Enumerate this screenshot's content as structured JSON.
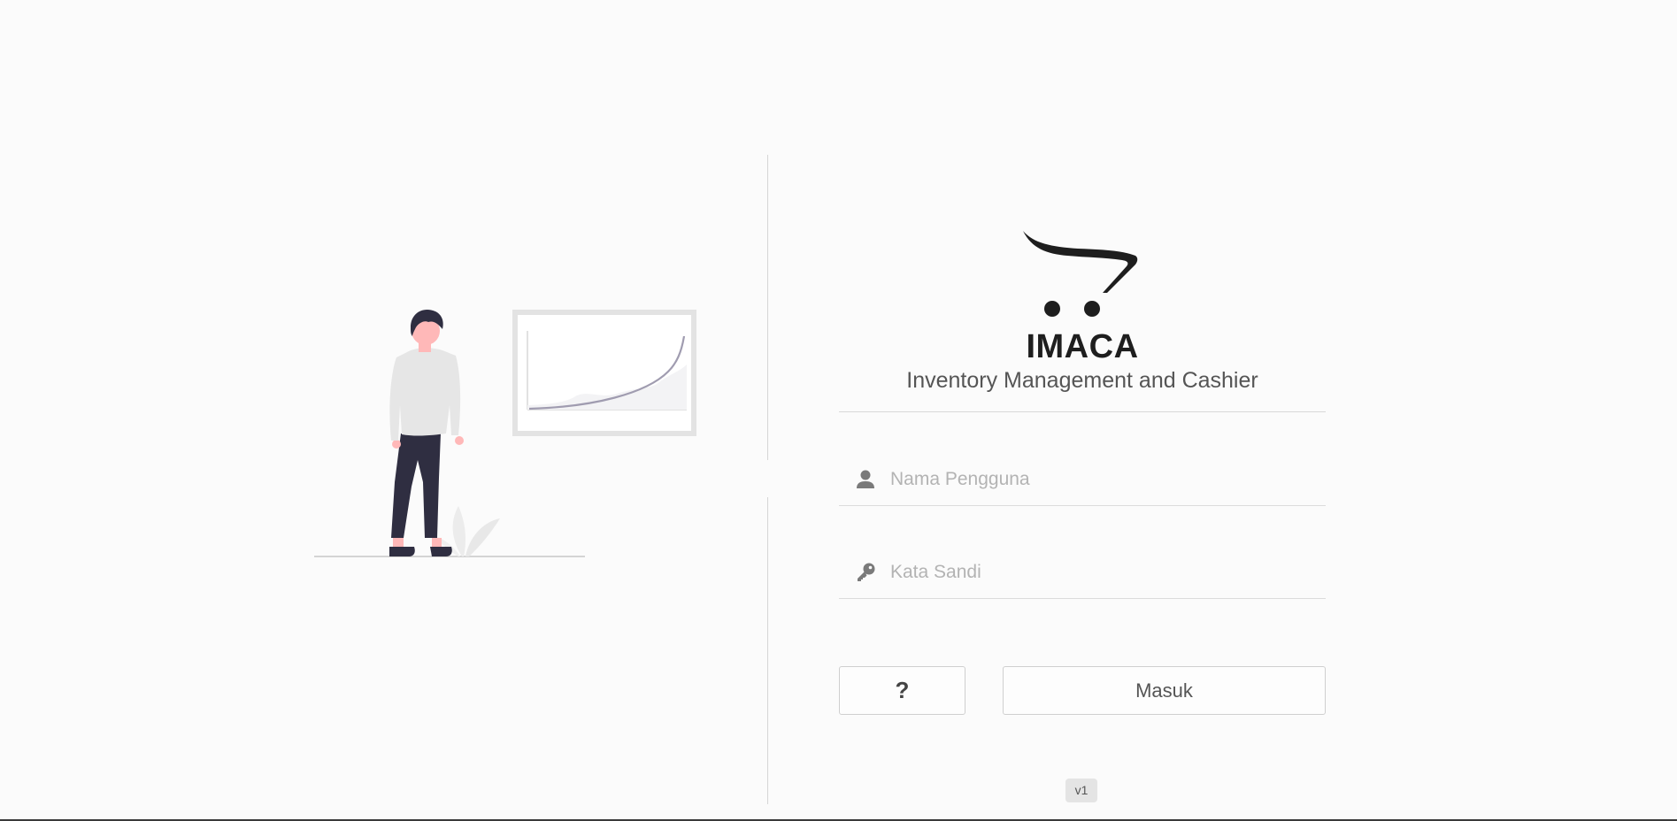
{
  "brand": {
    "name": "IMACA",
    "tagline": "Inventory Management and Cashier",
    "logo_icon": "shopping-cart-icon"
  },
  "form": {
    "username": {
      "placeholder": "Nama Pengguna",
      "value": "",
      "icon": "user-icon"
    },
    "password": {
      "placeholder": "Kata Sandi",
      "value": "",
      "icon": "key-icon"
    },
    "help_label": "?",
    "login_label": "Masuk"
  },
  "version": "v1",
  "colors": {
    "background": "#fbfbfb",
    "text_dark": "#1e1e1e",
    "figure_pants": "#2f2e41",
    "figure_skin": "#ffb8b8",
    "chart_line": "#a09cb0"
  }
}
